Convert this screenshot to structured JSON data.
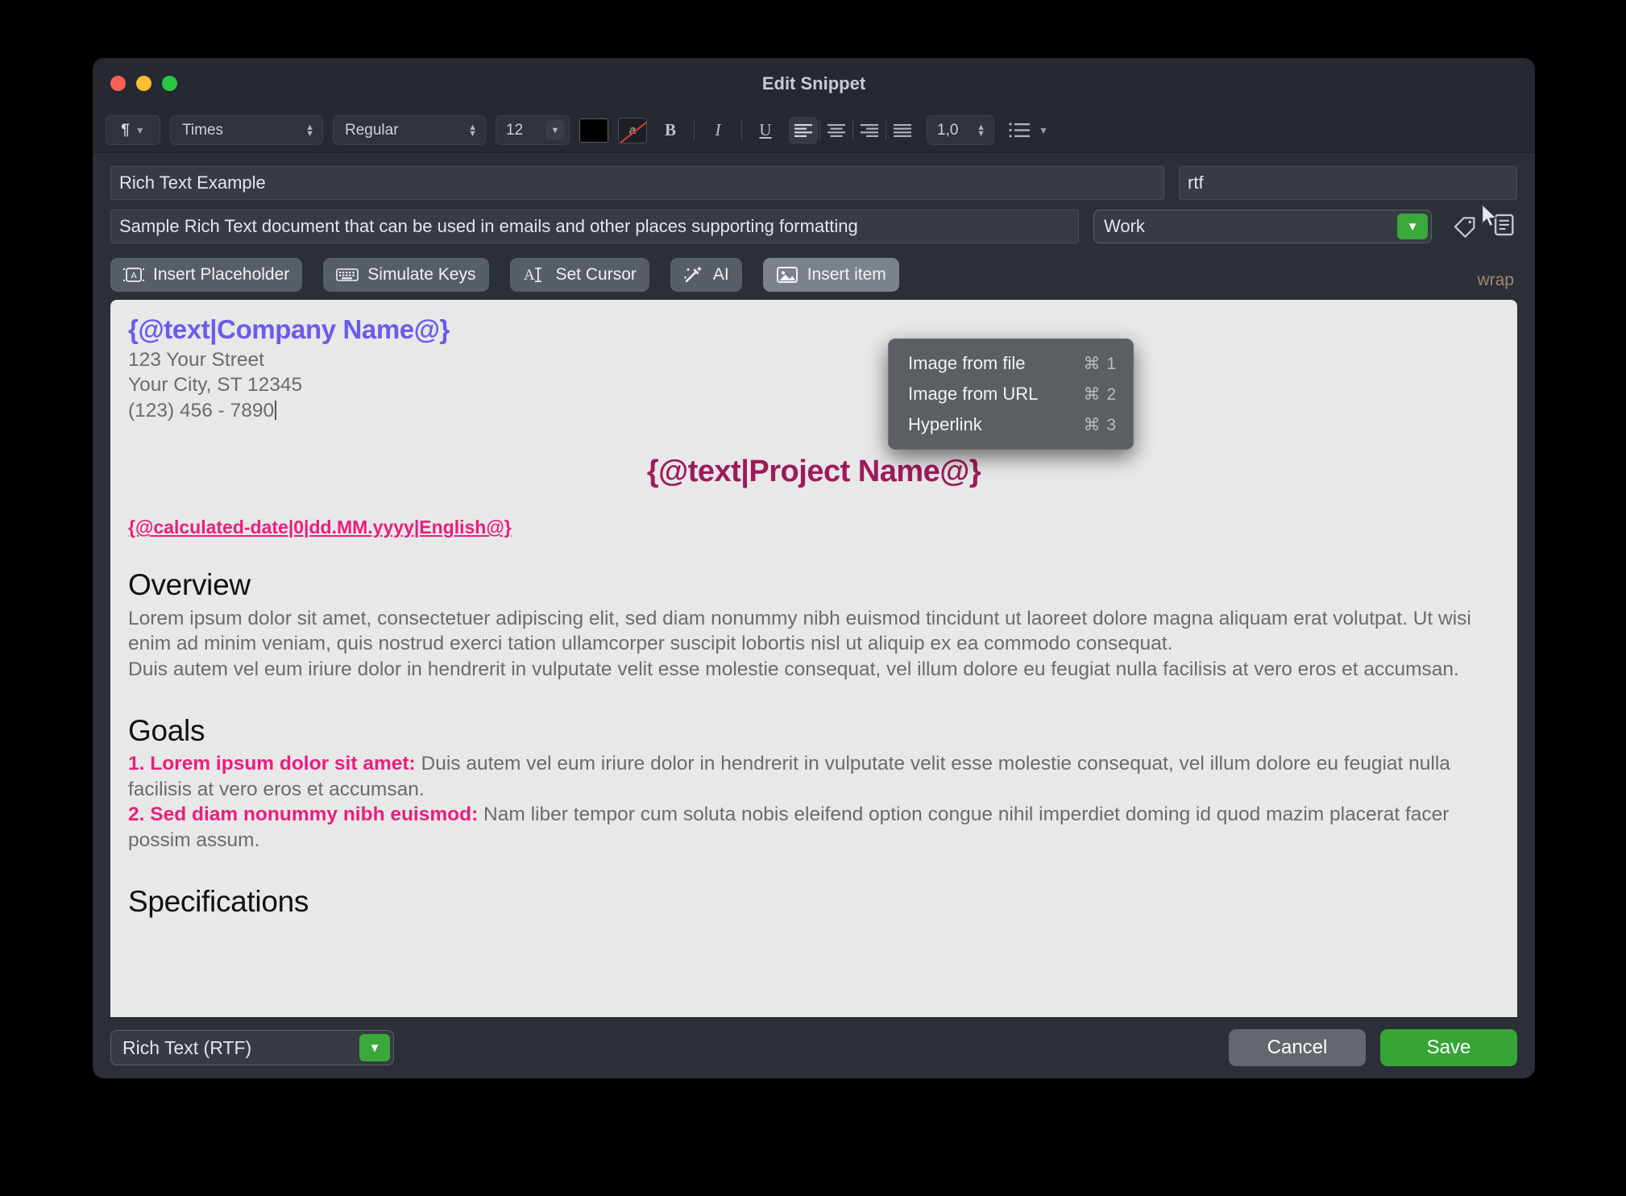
{
  "window": {
    "title": "Edit Snippet",
    "traffic_lights": [
      "close",
      "minimize",
      "zoom"
    ]
  },
  "toolbar": {
    "paragraph_icon": "pilcrow-icon",
    "font_family": "Times",
    "font_style": "Regular",
    "font_size": "12",
    "text_color": "#000000",
    "highlight_color_icon": "no-highlight-icon",
    "bold_label": "B",
    "italic_label": "I",
    "underline_label": "U",
    "align_active": "left",
    "line_spacing": "1,0",
    "list_icon": "bullet-list-icon"
  },
  "fields": {
    "name_value": "Rich Text Example",
    "abbreviation_value": "rtf",
    "description_value": "Sample Rich Text document that can be used in emails and other places supporting formatting",
    "group_value": "Work",
    "tag_icon": "tag-icon",
    "notes_icon": "notes-icon"
  },
  "actions": {
    "insert_placeholder": "Insert Placeholder",
    "simulate_keys": "Simulate Keys",
    "set_cursor": "Set Cursor",
    "ai": "AI",
    "insert_item": "Insert item",
    "wrap_label": "wrap"
  },
  "menu": {
    "items": [
      {
        "label": "Image from file",
        "shortcut": "⌘ 1"
      },
      {
        "label": "Image from URL",
        "shortcut": "⌘ 2"
      },
      {
        "label": "Hyperlink",
        "shortcut": "⌘ 3"
      }
    ]
  },
  "document": {
    "company_placeholder": "{@text|Company Name@}",
    "address_line1": "123 Your Street",
    "address_line2": "Your City, ST 12345",
    "address_line3": "(123) 456 - 7890",
    "project_placeholder": "{@text|Project Name@}",
    "date_placeholder": "{@calculated-date|0|dd.MM.yyyy|English@}",
    "overview_heading": "Overview",
    "overview_p1": "Lorem ipsum dolor sit amet, consectetuer adipiscing elit, sed diam nonummy nibh euismod tincidunt ut laoreet dolore magna aliquam erat volutpat. Ut wisi enim ad minim veniam, quis nostrud exerci tation ullamcorper suscipit lobortis nisl ut aliquip ex ea commodo consequat.",
    "overview_p2": "Duis autem vel eum iriure dolor in hendrerit in vulputate velit esse molestie consequat, vel illum dolore eu feugiat nulla facilisis at vero eros et accumsan.",
    "goals_heading": "Goals",
    "goal1_label": "1. Lorem ipsum dolor sit amet:",
    "goal1_text": " Duis autem vel eum iriure dolor in hendrerit in vulputate velit esse molestie consequat, vel illum dolore eu feugiat nulla facilisis at vero eros et accumsan.",
    "goal2_label": "2. Sed diam nonummy nibh euismod:",
    "goal2_text": " Nam liber tempor cum soluta nobis eleifend option congue nihil imperdiet doming id quod mazim placerat facer possim assum.",
    "specifications_heading": "Specifications"
  },
  "footer": {
    "format_value": "Rich Text (RTF)",
    "cancel_label": "Cancel",
    "save_label": "Save"
  },
  "colors": {
    "accent_green": "#36a536",
    "placeholder_indigo": "#6a5bea",
    "placeholder_pink": "#ec1d7c",
    "project_maroon": "#9e1b5a",
    "wrap_tan": "#a08a72"
  }
}
